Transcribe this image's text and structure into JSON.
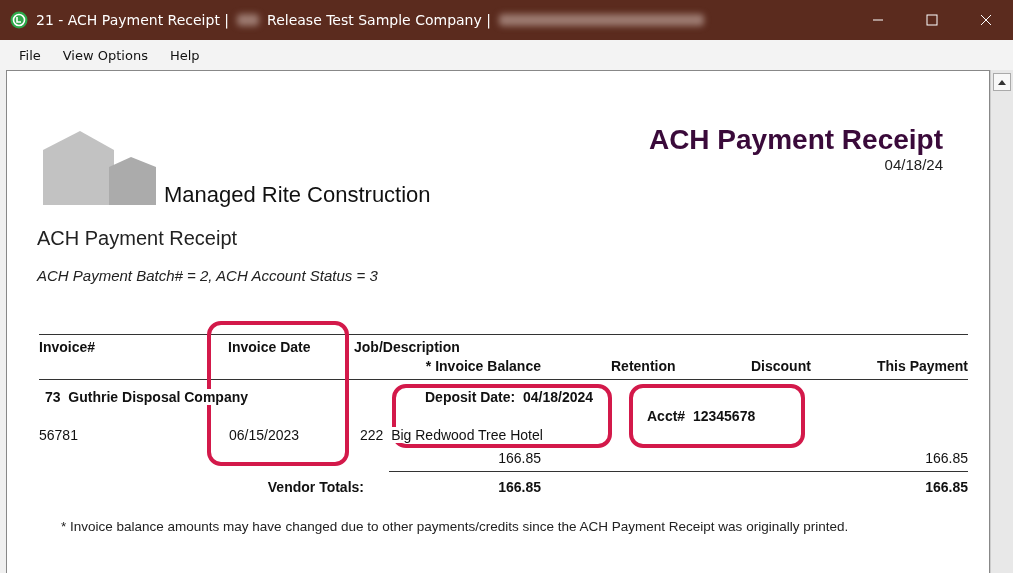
{
  "window": {
    "title_parts": [
      "21 - ACH Payment Receipt |",
      "Release Test Sample Company |"
    ]
  },
  "menu": [
    "File",
    "View Options",
    "Help"
  ],
  "report": {
    "company": "Managed Rite Construction",
    "title": "ACH Payment Receipt",
    "date": "04/18/24",
    "subtitle": "ACH Payment Receipt",
    "batch_line": "ACH Payment Batch# = 2, ACH Account Status = 3",
    "columns": {
      "invoice": "Invoice#",
      "invoice_date": "Invoice Date",
      "job": "Job/Description",
      "balance": "* Invoice Balance",
      "retention": "Retention",
      "discount": "Discount",
      "payment": "This Payment"
    },
    "vendor": {
      "name": "73  Guthrie Disposal Company",
      "deposit_date": "Deposit Date:  04/18/2024",
      "account": "Acct#  12345678"
    },
    "rows": [
      {
        "invoice": "56781",
        "invoice_date": "06/15/2023",
        "job": "222  Big Redwood Tree Hotel",
        "balance": "166.85",
        "payment": "166.85"
      }
    ],
    "totals": {
      "label": "Vendor Totals:",
      "balance": "166.85",
      "payment": "166.85"
    },
    "footnote": "* Invoice balance amounts may have changed due to other payments/credits since the ACH Payment Receipt was originally printed."
  },
  "highlights": {
    "invoice_date": true,
    "deposit_date": true,
    "account": true
  }
}
